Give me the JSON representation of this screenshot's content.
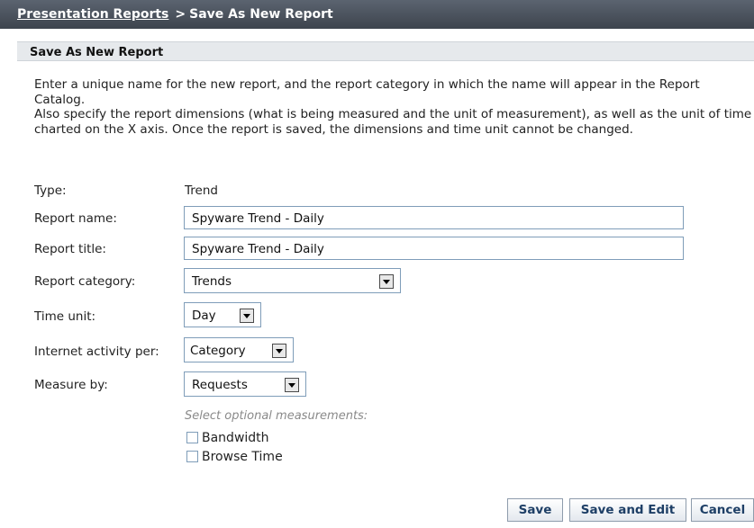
{
  "breadcrumb": {
    "parent": "Presentation Reports",
    "separator": ">",
    "current": "Save As New Report"
  },
  "panel": {
    "title": "Save As New Report"
  },
  "intro": {
    "line1": "Enter a unique name for the new report, and the report category in which the name will appear in the Report Catalog.",
    "line2": "Also specify the report dimensions (what is being measured and the unit of measurement), as well as the unit of time charted on the X axis. Once the report is saved, the dimensions and time unit cannot be changed."
  },
  "form": {
    "type_label": "Type:",
    "type_value": "Trend",
    "report_name_label": "Report name:",
    "report_name_value": "Spyware Trend - Daily",
    "report_title_label": "Report title:",
    "report_title_value": "Spyware Trend - Daily",
    "report_category_label": "Report category:",
    "report_category_value": "Trends",
    "time_unit_label": "Time unit:",
    "time_unit_value": "Day",
    "internet_activity_label": "Internet activity per:",
    "internet_activity_value": "Category",
    "measure_by_label": "Measure by:",
    "measure_by_value": "Requests",
    "optional_hint": "Select optional measurements:",
    "optional_measurements": [
      {
        "label": "Bandwidth",
        "checked": false
      },
      {
        "label": "Browse Time",
        "checked": false
      }
    ]
  },
  "buttons": {
    "save": "Save",
    "save_and_edit": "Save and Edit",
    "cancel": "Cancel"
  }
}
